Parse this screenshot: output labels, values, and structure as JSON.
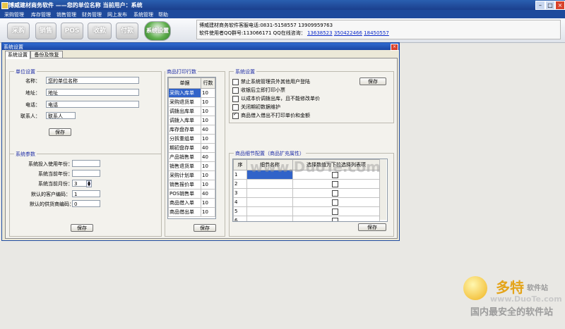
{
  "window": {
    "title": "博威建材商务软件 ——您的单位名称  当前用户：系统"
  },
  "menu": [
    "采购管理",
    "库存管理",
    "销售管理",
    "财务管理",
    "网上发布",
    "系统管理",
    "帮助"
  ],
  "toolbar": {
    "buttons": [
      "采购",
      "销售",
      "POS",
      "收款",
      "付款",
      "系统设置"
    ]
  },
  "info": {
    "line1": "博威建材商务软件客服电话:0831-5158557 13909959763",
    "line2_prefix": "软件使用者QQ群号:113066171  QQ在线咨询：",
    "qq_links": [
      "13638523",
      "350422466",
      "18450557"
    ]
  },
  "dialog": {
    "title": "系统设置",
    "close": "×",
    "tabs": [
      "系统设置",
      "备份及恢复"
    ]
  },
  "unit": {
    "group_title": "单位设置",
    "fields": [
      {
        "label": "名称：",
        "value": "您的单位名称"
      },
      {
        "label": "地址：",
        "value": "地址"
      },
      {
        "label": "电话：",
        "value": "电话"
      },
      {
        "label": "联系人：",
        "value": "联系人"
      }
    ],
    "save": "保存"
  },
  "params": {
    "group_title": "系统参数",
    "fields": [
      {
        "label": "系统投入使用年份：",
        "value": ""
      },
      {
        "label": "系统当前年份：",
        "value": ""
      },
      {
        "label": "系统当前月份：",
        "value": "3"
      },
      {
        "label": "默认的客户编码：",
        "value": "1"
      },
      {
        "label": "默认的供货商编码：",
        "value": "0"
      }
    ],
    "save": "保存"
  },
  "print": {
    "group_title": "商品打印行数",
    "headers": [
      "单据",
      "行数"
    ],
    "rows": [
      [
        "采购入库单",
        "10"
      ],
      [
        "采购退货单",
        "10"
      ],
      [
        "调拨出库单",
        "10"
      ],
      [
        "调拨入库单",
        "10"
      ],
      [
        "库存盘存单",
        "40"
      ],
      [
        "分拆重组单",
        "10"
      ],
      [
        "期初盘存单",
        "40"
      ],
      [
        "产品销售单",
        "40"
      ],
      [
        "销售退货单",
        "10"
      ],
      [
        "采购计划单",
        "10"
      ],
      [
        "销售报价单",
        "10"
      ],
      [
        "POS销售单",
        "40"
      ],
      [
        "商品借入单",
        "10"
      ],
      [
        "商品借出单",
        "10"
      ]
    ],
    "save": "保存"
  },
  "settings": {
    "group_title": "系统设置",
    "options": [
      {
        "label": "禁止系统管理员外其他用户登陆",
        "checked": false
      },
      {
        "label": "收银后立即打印小票",
        "checked": false
      },
      {
        "label": "以成本价调拨出库，且不能修改单价",
        "checked": false
      },
      {
        "label": "关闭期初数据维护",
        "checked": false
      },
      {
        "label": "商品借入借出不打印单价和金额",
        "checked": true
      }
    ],
    "save": "保存"
  },
  "detail": {
    "group_title": "商品细节配置（商品扩充属性）",
    "headers": [
      "序",
      "细节名称",
      "选择数值为下拉选择列表项"
    ],
    "rows": [
      "1",
      "2",
      "3",
      "4",
      "5",
      "6"
    ],
    "save": "保存"
  },
  "watermark": {
    "center": "www.DuoTe.com",
    "brand": "多特",
    "brand_sub": "软件站",
    "url": "www.DuoTe.com",
    "slogan": "国内最安全的软件站"
  },
  "colors": {
    "titlebar": "#1b3f8d",
    "menubar": "#1e4a9c",
    "selection": "#3163c9",
    "group_title": "#1f2ea6"
  }
}
